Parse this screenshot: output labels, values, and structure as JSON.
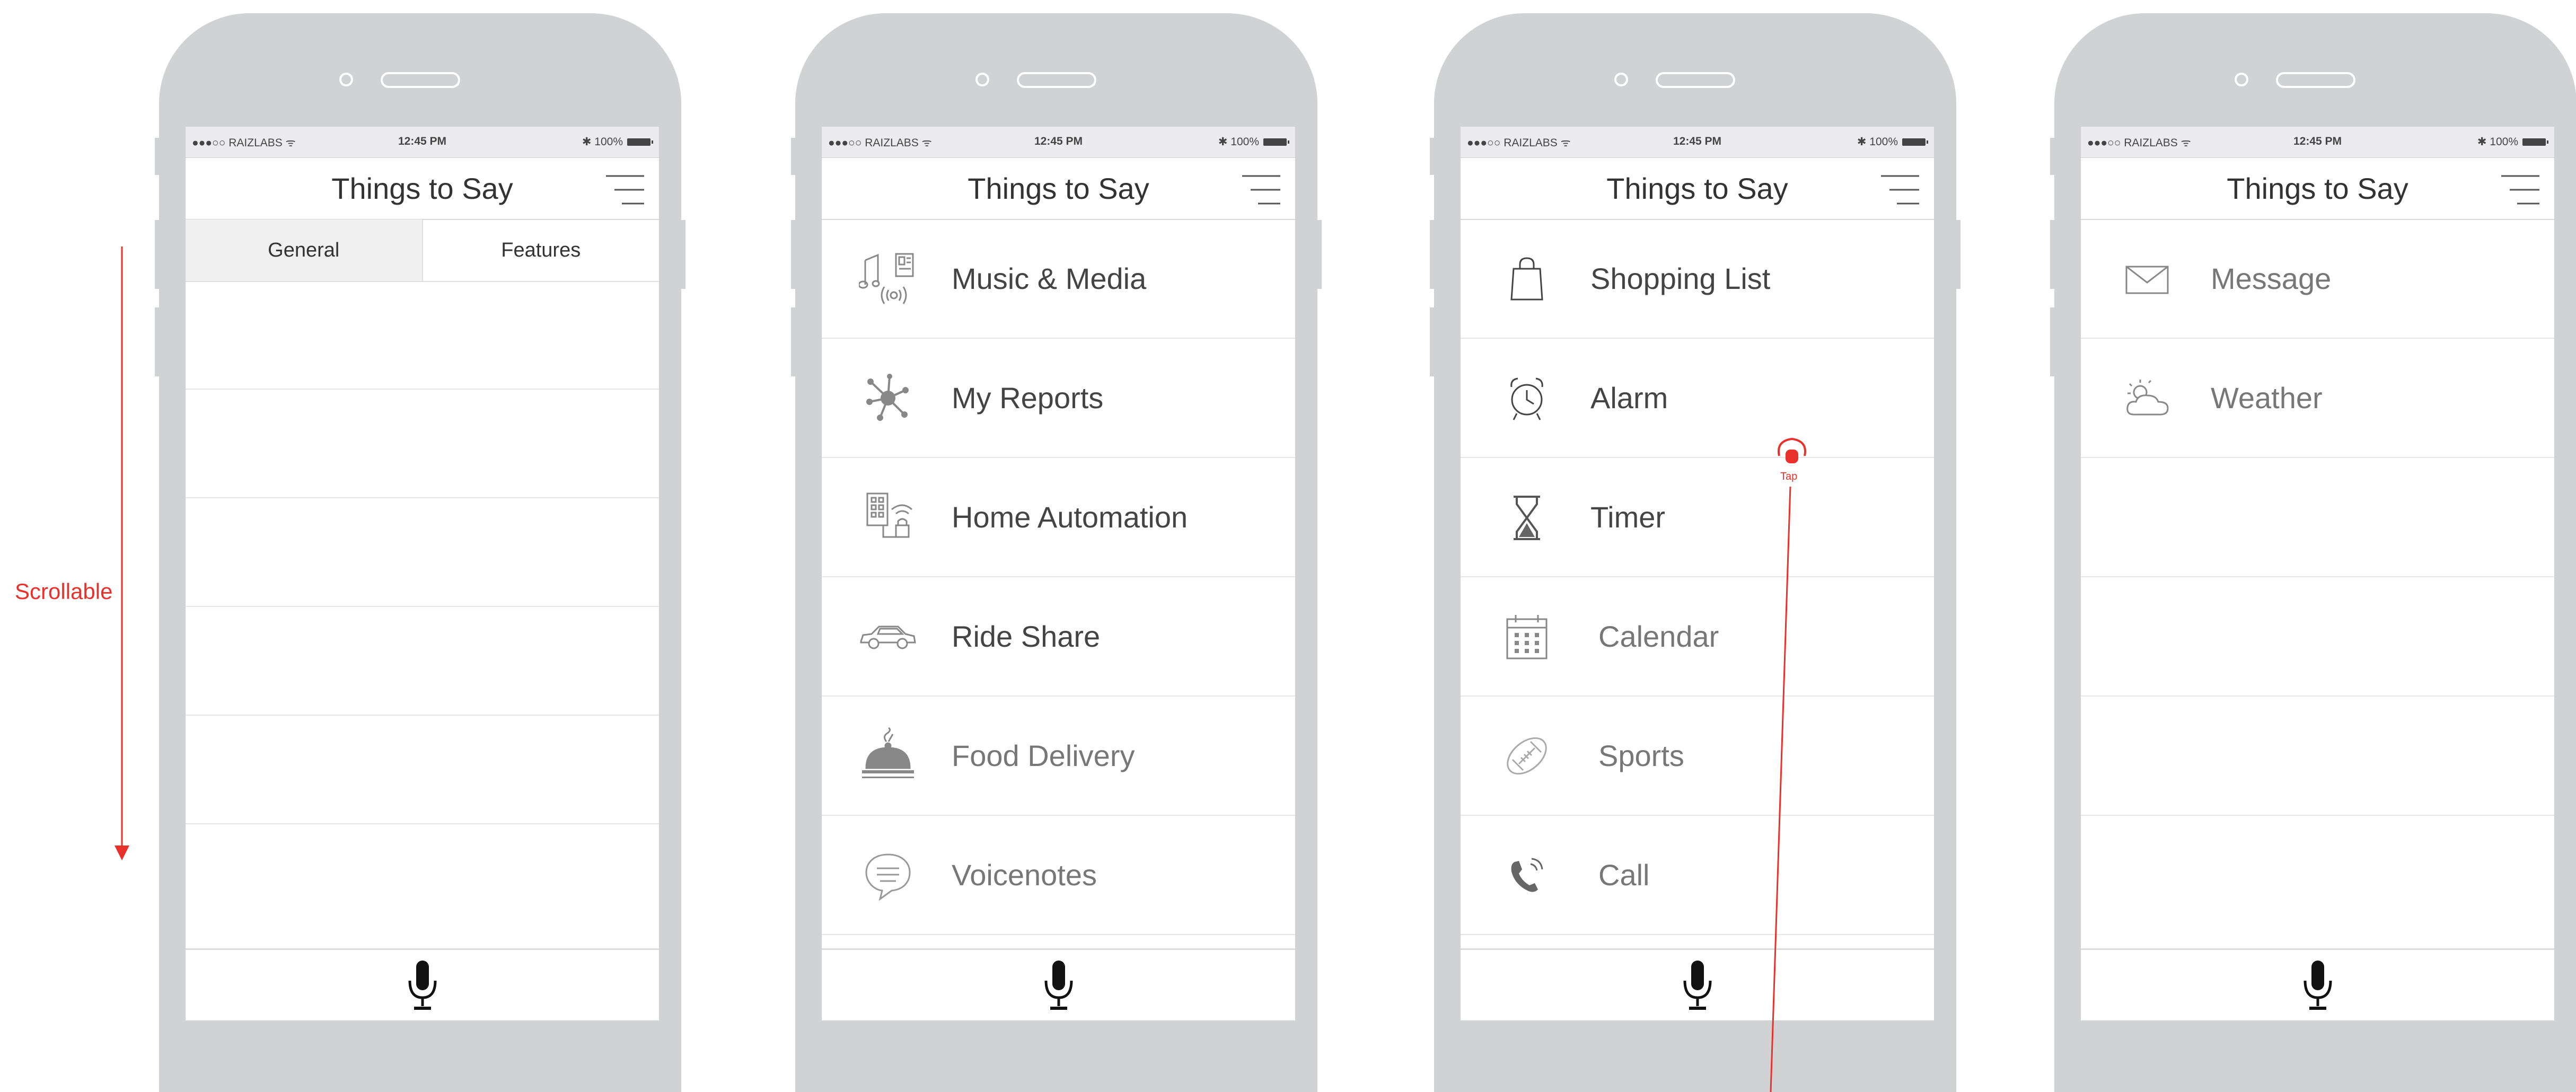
{
  "status_bar": {
    "carrier": "●●●○○ RAIZLABS ᯤ",
    "time": "12:45 PM",
    "battery": "✱ 100%"
  },
  "nav": {
    "title": "Things to Say"
  },
  "tabs": {
    "general": "General",
    "features": "Features"
  },
  "screen2": {
    "items": [
      "Music & Media",
      "My Reports",
      "Home Automation",
      "Ride Share",
      "Food Delivery",
      "Voicenotes"
    ]
  },
  "screen3": {
    "items": [
      "Shopping List",
      "Alarm",
      "Timer",
      "Calendar",
      "Sports",
      "Call"
    ]
  },
  "screen4": {
    "items": [
      "Message",
      "Weather"
    ]
  },
  "annotations": {
    "scrollable": "Scrollable",
    "tap": "Tap"
  },
  "colors": {
    "annotation": "#e8312a",
    "phone_body": "#d1d2d4"
  },
  "icons": {
    "screen2": [
      "music-media-icon",
      "reports-icon",
      "home-automation-icon",
      "car-icon",
      "food-delivery-icon",
      "voicenote-icon"
    ],
    "screen3": [
      "shopping-bag-icon",
      "alarm-clock-icon",
      "hourglass-icon",
      "calendar-icon",
      "football-icon",
      "phone-icon"
    ],
    "screen4": [
      "envelope-icon",
      "weather-icon"
    ]
  }
}
